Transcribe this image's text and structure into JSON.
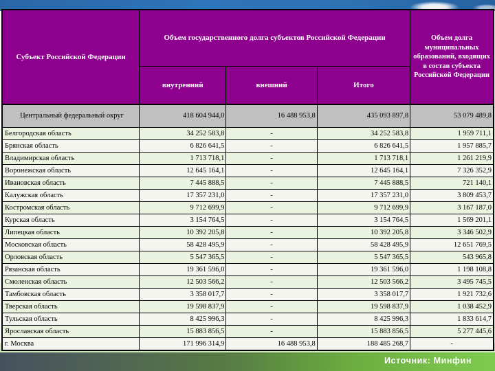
{
  "slide": {
    "source_note": "Источник: Минфин"
  },
  "table": {
    "header": {
      "subject": "Субъект Российской Федерации",
      "state_debt_group": "Объем государственного долга субъектов Российской Федерации",
      "internal": "внутренний",
      "external": "внешний",
      "total": "Итого",
      "municipal": "Объем долга муниципальных образований, входящих в состав субъекта Российской Федерации"
    },
    "rows": [
      {
        "region": "Центральный федеральный округ",
        "internal": "418 604 944,0",
        "external": "16 488 953,8",
        "total": "435 093 897,8",
        "municipal": "53 079 489,8",
        "highlight": true
      },
      {
        "region": "Белгородская область",
        "internal": "34 252 583,8",
        "external": "-",
        "total": "34 252 583,8",
        "municipal": "1 959 711,1"
      },
      {
        "region": "Брянская область",
        "internal": "6 826 641,5",
        "external": "-",
        "total": "6 826 641,5",
        "municipal": "1 957 885,7"
      },
      {
        "region": "Владимирская область",
        "internal": "1 713 718,1",
        "external": "-",
        "total": "1 713 718,1",
        "municipal": "1 261 219,9"
      },
      {
        "region": "Воронежская область",
        "internal": "12 645 164,1",
        "external": "-",
        "total": "12 645 164,1",
        "municipal": "7 326 352,9"
      },
      {
        "region": "Ивановская область",
        "internal": "7 445 888,5",
        "external": "-",
        "total": "7 445 888,5",
        "municipal": "721 140,1"
      },
      {
        "region": "Калужская область",
        "internal": "17 357 231,0",
        "external": "-",
        "total": "17 357 231,0",
        "municipal": "3 809 453,7"
      },
      {
        "region": "Костромская область",
        "internal": "9 712 699,9",
        "external": "-",
        "total": "9 712 699,9",
        "municipal": "3 167 187,0"
      },
      {
        "region": "Курская область",
        "internal": "3 154 764,5",
        "external": "-",
        "total": "3 154 764,5",
        "municipal": "1 569 201,1"
      },
      {
        "region": "Липецкая область",
        "internal": "10 392 205,8",
        "external": "-",
        "total": "10 392 205,8",
        "municipal": "3 346 502,9"
      },
      {
        "region": "Московская область",
        "internal": "58 428 495,9",
        "external": "-",
        "total": "58 428 495,9",
        "municipal": "12 651 769,5"
      },
      {
        "region": "Орловская область",
        "internal": "5 547 365,5",
        "external": "-",
        "total": "5 547 365,5",
        "municipal": "543 965,8"
      },
      {
        "region": "Рязанская область",
        "internal": "19 361 596,0",
        "external": "-",
        "total": "19 361 596,0",
        "municipal": "1 198 108,8"
      },
      {
        "region": "Смоленская область",
        "internal": "12 503 566,2",
        "external": "-",
        "total": "12 503 566,2",
        "municipal": "3 495 745,5"
      },
      {
        "region": "Тамбовская область",
        "internal": "3 358 017,7",
        "external": "-",
        "total": "3 358 017,7",
        "municipal": "1 921 732,6"
      },
      {
        "region": "Тверская область",
        "internal": "19 598 837,9",
        "external": "-",
        "total": "19 598 837,9",
        "municipal": "1 038 452,9"
      },
      {
        "region": "Тульская область",
        "internal": "8 425 996,3",
        "external": "-",
        "total": "8 425 996,3",
        "municipal": "1 833 614,7"
      },
      {
        "region": "Ярославская область",
        "internal": "15 883 856,5",
        "external": "-",
        "total": "15 883 856,5",
        "municipal": "5 277 445,6"
      },
      {
        "region": "г. Москва",
        "internal": "171 996 314,9",
        "external": "16 488 953,8",
        "total": "188 485 268,7",
        "municipal": "-"
      }
    ]
  },
  "colors": {
    "header_bg": "#8e008e",
    "district_row_bg": "#c0c0c0",
    "row_green": "#e9f3df",
    "row_white": "#f5f5f0",
    "sky_blue": "#2e74b8",
    "footer_slate": "#45525e",
    "footer_green": "#6cae3f",
    "strip_green": "#cfe9ba"
  }
}
